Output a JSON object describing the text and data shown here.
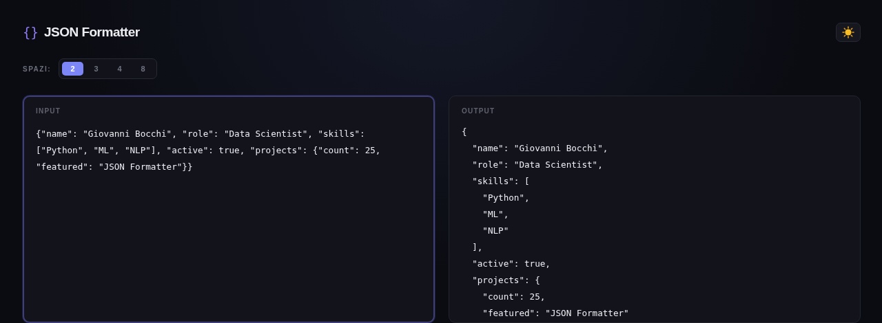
{
  "header": {
    "logo": "{}",
    "title": "JSON Formatter"
  },
  "indent": {
    "label": "SPAZI:",
    "options": [
      {
        "label": "2",
        "selected": true
      },
      {
        "label": "3",
        "selected": false
      },
      {
        "label": "4",
        "selected": false
      },
      {
        "label": "8",
        "selected": false
      }
    ]
  },
  "input": {
    "label": "INPUT",
    "value": "{\"name\": \"Giovanni Bocchi\", \"role\": \"Data Scientist\", \"skills\": [\"Python\", \"ML\", \"NLP\"], \"active\": true, \"projects\": {\"count\": 25, \"featured\": \"JSON Formatter\"}}",
    "focused": true
  },
  "output": {
    "label": "OUTPUT",
    "lines": [
      "{",
      "  \"name\": \"Giovanni Bocchi\",",
      "  \"role\": \"Data Scientist\",",
      "  \"skills\": [",
      "    \"Python\",",
      "    \"ML\",",
      "    \"NLP\"",
      "  ],",
      "  \"active\": true,",
      "  \"projects\": {",
      "    \"count\": 25,",
      "    \"featured\": \"JSON Formatter\""
    ]
  }
}
